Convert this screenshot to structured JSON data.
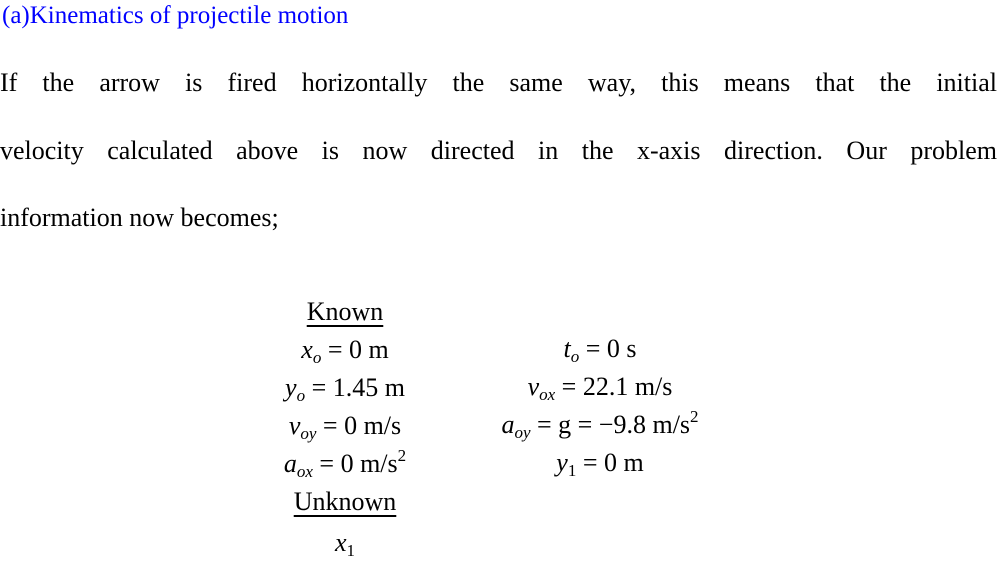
{
  "heading": "(a)Kinematics of projectile motion",
  "paragraph": {
    "lines": [
      "If the arrow is fired horizontally the same way, this means that the initial",
      "velocity calculated above is now directed in the x-axis direction.  Our problem",
      "information now becomes;"
    ]
  },
  "known": {
    "title": "Known",
    "left": [
      {
        "var": "x",
        "sub": "o",
        "rhs": "= 0 m",
        "sup": ""
      },
      {
        "var": "y",
        "sub": "o",
        "rhs": "= 1.45 m",
        "sup": ""
      },
      {
        "var": "v",
        "sub": "oy",
        "rhs": "= 0 m/s",
        "sup": ""
      },
      {
        "var": "a",
        "sub": "ox",
        "rhs": "= 0 m/s",
        "sup": "2"
      }
    ],
    "right": [
      {
        "var": "t",
        "sub": "o",
        "rhs": "= 0 s",
        "sup": ""
      },
      {
        "var": "v",
        "sub": "ox",
        "rhs": "= 22.1 m/s",
        "sup": ""
      },
      {
        "var": "a",
        "sub": "oy",
        "rhs": "= g = −9.8 m/s",
        "sup": "2"
      },
      {
        "var": "y",
        "sub": "1",
        "rhs": "= 0 m",
        "sup": ""
      }
    ]
  },
  "unknown": {
    "title": "Unknown",
    "var": "x",
    "sub": "1"
  }
}
